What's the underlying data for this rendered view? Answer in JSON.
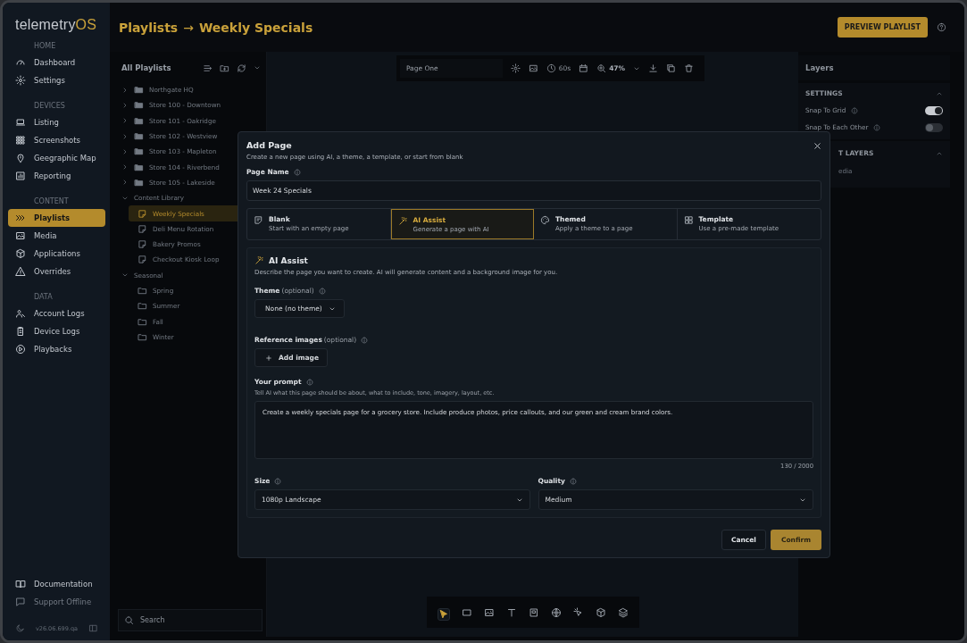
{
  "brand": {
    "text": "telemetry",
    "accent": "OS"
  },
  "sidebar": {
    "sections": [
      {
        "title": "HOME",
        "items": [
          {
            "label": "Dashboard",
            "selected": false
          },
          {
            "label": "Settings",
            "selected": false
          }
        ]
      },
      {
        "title": "DEVICES",
        "items": [
          {
            "label": "Listing",
            "selected": false
          },
          {
            "label": "Screenshots",
            "selected": false
          },
          {
            "label": "Geegraphic Map",
            "selected": false
          },
          {
            "label": "Reporting",
            "selected": false
          }
        ]
      },
      {
        "title": "CONTENT",
        "items": [
          {
            "label": "Playlists",
            "selected": true
          },
          {
            "label": "Media",
            "selected": false
          },
          {
            "label": "Applications",
            "selected": false
          },
          {
            "label": "Overrides",
            "selected": false
          }
        ]
      },
      {
        "title": "DATA",
        "items": [
          {
            "label": "Account Logs",
            "selected": false
          },
          {
            "label": "Device Logs",
            "selected": false
          },
          {
            "label": "Playbacks",
            "selected": false
          }
        ]
      }
    ],
    "footer": [
      {
        "label": "Documentation",
        "disabled": false
      },
      {
        "label": "Support Offline",
        "disabled": true
      }
    ],
    "version": "v26.06.699.qa"
  },
  "header": {
    "breadcrumb": [
      {
        "label": "Playlists",
        "kind": "link"
      },
      {
        "label": "→",
        "kind": "separator"
      },
      {
        "label": "Weekly Specials",
        "kind": "current"
      }
    ],
    "preview_button": "PREVIEW PLAYLIST"
  },
  "tree": {
    "title": "All Playlists",
    "search": {
      "placeholder": "Search"
    },
    "items": [
      {
        "label": "Northgate HQ",
        "kind": "folder",
        "expanded": false
      },
      {
        "label": "Store 100 - Downtown",
        "kind": "folder",
        "expanded": false
      },
      {
        "label": "Store 101 - Oakridge",
        "kind": "folder",
        "expanded": false
      },
      {
        "label": "Store 102 - Westview",
        "kind": "folder",
        "expanded": false
      },
      {
        "label": "Store 103 - Mapleton",
        "kind": "folder",
        "expanded": false
      },
      {
        "label": "Store 104 - Riverbend",
        "kind": "folder",
        "expanded": false
      },
      {
        "label": "Store 105 - Lakeside",
        "kind": "folder",
        "expanded": false
      },
      {
        "label": "Content Library",
        "kind": "group",
        "expanded": true,
        "children": [
          {
            "label": "Weekly Specials",
            "kind": "playlist",
            "selected": true
          },
          {
            "label": "Deli Menu Rotation",
            "kind": "playlist",
            "selected": false
          },
          {
            "label": "Bakery Promos",
            "kind": "playlist",
            "selected": false
          },
          {
            "label": "Checkout Kiosk Loop",
            "kind": "playlist",
            "selected": false
          }
        ]
      },
      {
        "label": "Seasonal",
        "kind": "group",
        "expanded": true,
        "children": [
          {
            "label": "Spring",
            "kind": "subfolder",
            "selected": false
          },
          {
            "label": "Summer",
            "kind": "subfolder",
            "selected": false
          },
          {
            "label": "Fall",
            "kind": "subfolder",
            "selected": false
          },
          {
            "label": "Winter",
            "kind": "subfolder",
            "selected": false
          }
        ]
      }
    ]
  },
  "toolbar": {
    "page_name": "Page One",
    "duration": "60s",
    "zoom": "47%"
  },
  "layers": {
    "title": "Layers",
    "settings_title": "SETTINGS",
    "toggles": [
      {
        "label": "Snap To Grid",
        "on": true
      },
      {
        "label": "Snap To Each Other",
        "on": false
      }
    ],
    "section_title": "T LAYERS",
    "items": [
      "edia"
    ]
  },
  "tools": [
    {
      "kind": "pointer",
      "selected": true
    },
    {
      "kind": "rectangle",
      "selected": false
    },
    {
      "kind": "image",
      "selected": false
    },
    {
      "kind": "text",
      "selected": false
    },
    {
      "kind": "widget",
      "selected": false
    },
    {
      "kind": "web",
      "selected": false
    },
    {
      "kind": "interactive",
      "selected": false
    },
    {
      "kind": "model",
      "selected": false
    },
    {
      "kind": "layers",
      "selected": false
    }
  ],
  "modal": {
    "title": "Add Page",
    "subtitle": "Create a new page using AI, a theme, a template, or start from blank",
    "page_name_label": "Page Name",
    "page_name": "Week 24 Specials",
    "options": [
      {
        "title": "Blank",
        "desc": "Start with an empty page",
        "selected": false
      },
      {
        "title": "AI Assist",
        "desc": "Generate a page with AI",
        "selected": true
      },
      {
        "title": "Themed",
        "desc": "Apply a theme to a page",
        "selected": false
      },
      {
        "title": "Template",
        "desc": "Use a pre-made template",
        "selected": false
      }
    ],
    "section_title": "AI Assist",
    "section_desc": "Describe the page you want to create. AI will generate content and a background image for you.",
    "theme_label": "Theme",
    "theme_hint": "(optional)",
    "theme_value": "None (no theme)",
    "ref_label": "Reference images",
    "ref_hint": "(optional)",
    "add_image": "Add image",
    "prompt_label": "Your prompt",
    "prompt_help": "Tell AI what this page should be about, what to include, tone, imagery, layout, etc.",
    "prompt": "Create a weekly specials page for a grocery store. Include produce photos, price callouts, and our green and cream brand colors.",
    "counter": "130 / 2000",
    "size_label": "Size",
    "size_value": "1080p Landscape",
    "quality_label": "Quality",
    "quality_value": "Medium",
    "cancel": "Cancel",
    "confirm": "Confirm"
  }
}
